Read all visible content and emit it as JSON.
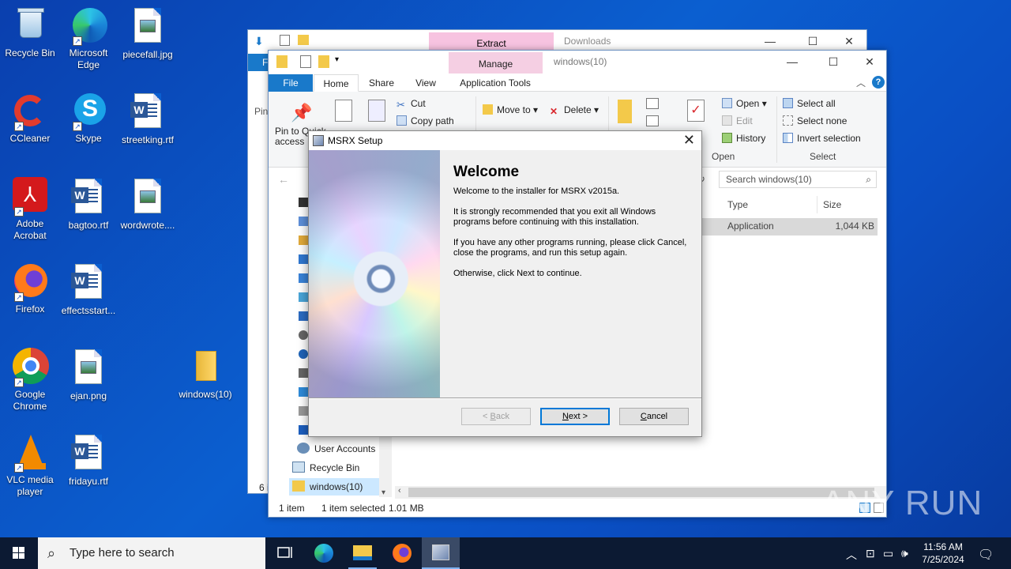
{
  "desktop": {
    "icons": [
      {
        "label": "Recycle Bin"
      },
      {
        "label": "Microsoft Edge"
      },
      {
        "label": "piecefall.jpg"
      },
      {
        "label": "CCleaner"
      },
      {
        "label": "Skype"
      },
      {
        "label": "streetking.rtf"
      },
      {
        "label": "Adobe Acrobat"
      },
      {
        "label": "bagtoo.rtf"
      },
      {
        "label": "wordwrote...."
      },
      {
        "label": "Firefox"
      },
      {
        "label": "effectsstart..."
      },
      {
        "label": "Google Chrome"
      },
      {
        "label": "ejan.png"
      },
      {
        "label": "windows(10)"
      },
      {
        "label": "VLC media player"
      },
      {
        "label": "fridayu.rtf"
      }
    ]
  },
  "back_window": {
    "context_tab": "Extract",
    "title": "Downloads",
    "file_tab": "F",
    "ribbon_fragment": "Pin",
    "status_fragment": "6 i"
  },
  "front_window": {
    "context_tab": "Manage",
    "title": "windows(10)",
    "tabs": {
      "file": "File",
      "home": "Home",
      "share": "Share",
      "view": "View",
      "app_tools": "Application Tools"
    },
    "ribbon": {
      "pin": "Pin to Quick access",
      "cut": "Cut",
      "copy_path": "Copy path",
      "move_to": "Move to",
      "delete": "Delete",
      "properties": "Properties",
      "open": "Open",
      "edit": "Edit",
      "history": "History",
      "open_group": "Open",
      "select_all": "Select all",
      "select_none": "Select none",
      "invert_selection": "Invert selection",
      "select_group": "Select"
    },
    "search_placeholder": "Search windows(10)",
    "columns": {
      "type": "Type",
      "size": "Size"
    },
    "row": {
      "type": "Application",
      "size": "1,044 KB"
    },
    "nav": {
      "user_accounts": "User Accounts",
      "recycle_bin": "Recycle Bin",
      "windows10": "windows(10)"
    },
    "status": {
      "count": "1 item",
      "selected": "1 item selected",
      "size": "1.01 MB"
    }
  },
  "setup_dialog": {
    "title": "MSRX Setup",
    "heading": "Welcome",
    "p1": "Welcome to the installer for MSRX v2015a.",
    "p2": "It is strongly recommended that you exit all Windows programs before continuing with this installation.",
    "p3": "If you have any other programs running, please click Cancel, close the programs, and run this setup again.",
    "p4": "Otherwise, click Next to continue.",
    "back_key": "B",
    "back_rest": "ack",
    "back_prefix": "< ",
    "next_key": "N",
    "next_rest": "ext >",
    "cancel_key": "C",
    "cancel_rest": "ancel"
  },
  "taskbar": {
    "search_placeholder": "Type here to search",
    "time": "11:56 AM",
    "date": "7/25/2024"
  },
  "watermark": "ANY RUN",
  "colors": {
    "desktop_blue": "#0b5fd0",
    "ribbon_file": "#1979ca",
    "manage_pink": "#f5cfe3",
    "extract_pink": "#f7c3e0",
    "taskbar": "#0c1a33"
  }
}
